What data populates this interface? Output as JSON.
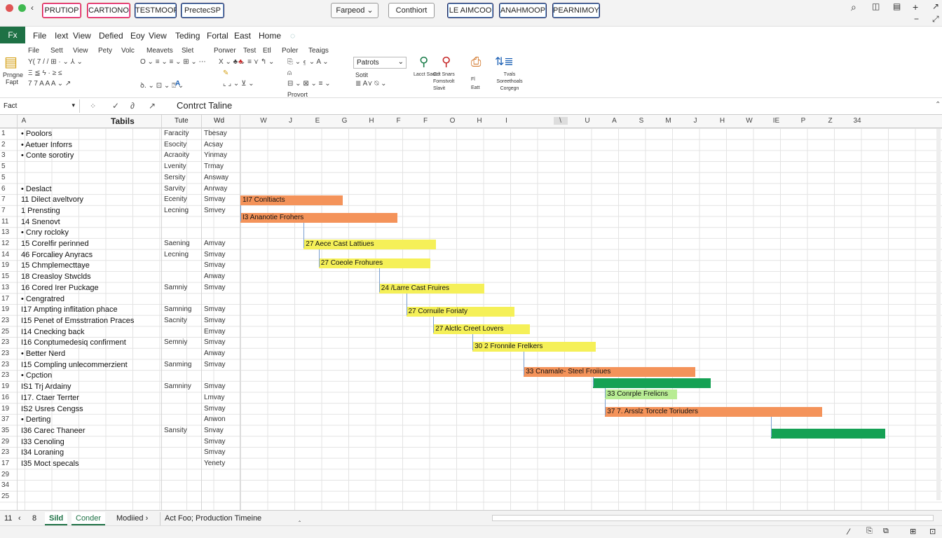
{
  "titlebar": {
    "buttons": [
      "PRUTIOP",
      "CARTIONO",
      "TESTMOOP",
      "PrectecSP",
      "Farpeod",
      "Conthiort",
      "LE AIMCOO",
      "ANAHMOOP",
      "PEARNIMOY"
    ],
    "dropdown": "⌄"
  },
  "menu": [
    "Fx",
    "File",
    "Iext",
    "View",
    "Defied",
    "Eoy",
    "View",
    "Teding",
    "Fortal",
    "East",
    "Home"
  ],
  "ribbon": {
    "sub": [
      "File",
      "Sett",
      "View",
      "Pety",
      "Volc",
      "Meavets",
      "Slet",
      "Porwer",
      "Test",
      "Etl",
      "Poler",
      "Teaigs"
    ],
    "font": "Patrots",
    "groups": [
      "Lacct Saotct Snars",
      "Crl Fomstvolt Slavit",
      "Fl Eatt",
      "Tvals Soreethoals Corgegn"
    ],
    "left": [
      "Prngne Fapt"
    ],
    "styles": "Sotit",
    "bottom": "Provort"
  },
  "formula_bar": {
    "name": "Fact",
    "value": "Contrct Taline"
  },
  "columns": [
    "W",
    "J",
    "E",
    "G",
    "H",
    "F",
    "F",
    "O",
    "H",
    "I",
    "",
    "\\",
    "U",
    "A",
    "S",
    "M",
    "J",
    "H",
    "W",
    "IE",
    "P",
    "Z",
    "34"
  ],
  "header": {
    "tasks": "Tabils",
    "resource": "Tute",
    "status": "Wd"
  },
  "rows": [
    {
      "n": "1",
      "task": "•  Poolors",
      "res": "Faracity",
      "stat": "Tbesay"
    },
    {
      "n": "2",
      "task": "•  Aetuer Inforrs",
      "res": "Esocity",
      "stat": "Acsay"
    },
    {
      "n": "3",
      "task": "•  Conte sorotiry",
      "res": "Acraoity",
      "stat": "Yinmay"
    },
    {
      "n": "5",
      "task": "",
      "res": "Lvenity",
      "stat": "Trmay"
    },
    {
      "n": "5",
      "task": "",
      "res": "Sersity",
      "stat": "Answay"
    },
    {
      "n": "6",
      "task": "•  Deslact",
      "res": "Sarvity",
      "stat": "Anrway"
    },
    {
      "n": "7",
      "task": "11  Dilect aveltvory",
      "res": "Ecenity",
      "stat": "Smvay"
    },
    {
      "n": "7",
      "task": "1   Prensting",
      "res": "Lecning",
      "stat": "Smvey"
    },
    {
      "n": "11",
      "task": "14  Snenovt",
      "res": "",
      "stat": ""
    },
    {
      "n": "13",
      "task": "    •  Cnry rocloky",
      "res": "",
      "stat": ""
    },
    {
      "n": "12",
      "task": "15  Corelfir perinned",
      "res": "Saening",
      "stat": "Amvay"
    },
    {
      "n": "14",
      "task": "46  Forcaliey Anyracs",
      "res": "Lecning",
      "stat": "Smvay"
    },
    {
      "n": "19",
      "task": "15  Chmplemecttaye",
      "res": "",
      "stat": "Smvay"
    },
    {
      "n": "15",
      "task": "18  Creasloy Stwclds",
      "res": "",
      "stat": "Anway"
    },
    {
      "n": "13",
      "task": "16  Cored Irer Puckage",
      "res": "Samniy",
      "stat": "Smvay"
    },
    {
      "n": "17",
      "task": "     •  Cengratred",
      "res": "",
      "stat": ""
    },
    {
      "n": "19",
      "task": "I17  Ampting inflitation phace",
      "res": "Samning",
      "stat": "Smvay"
    },
    {
      "n": "23",
      "task": "I15  Penet of Emsstrration Praces",
      "res": "Sacnity",
      "stat": "Smvay"
    },
    {
      "n": "25",
      "task": "I14  Cnecking back",
      "res": "",
      "stat": "Emvay"
    },
    {
      "n": "23",
      "task": "I16  Conptumedesiq confirment",
      "res": "Semniy",
      "stat": "Smvay"
    },
    {
      "n": "23",
      "task": "     •  Better Nerd",
      "res": "",
      "stat": "Anway"
    },
    {
      "n": "23",
      "task": "I15  Compling unlecommerzient",
      "res": "Sanming",
      "stat": "Smvay"
    },
    {
      "n": "23",
      "task": "     •  Cpction",
      "res": "",
      "stat": ""
    },
    {
      "n": "19",
      "task": "IS1  Trj Ardainy",
      "res": "Samniny",
      "stat": "Smvay"
    },
    {
      "n": "16",
      "task": "I17.  Ctaer Terrter",
      "res": "",
      "stat": "Lmvay"
    },
    {
      "n": "19",
      "task": "IS2  Usres Cengss",
      "res": "",
      "stat": "Smvay"
    },
    {
      "n": "37",
      "task": "     •  Derting",
      "res": "",
      "stat": "Anwon"
    },
    {
      "n": "35",
      "task": "I36  Carec Thaneer",
      "res": "Sansity",
      "stat": "Snvay"
    },
    {
      "n": "29",
      "task": "I33  Cenoling",
      "res": "",
      "stat": "Smvay"
    },
    {
      "n": "23",
      "task": "I34  Loraning",
      "res": "",
      "stat": "Smvay"
    },
    {
      "n": "17",
      "task": "I35  Moct specals",
      "res": "",
      "stat": "Yenety"
    },
    {
      "n": "29",
      "task": "",
      "res": "",
      "stat": ""
    },
    {
      "n": "34",
      "task": "",
      "res": "",
      "stat": ""
    },
    {
      "n": "25",
      "task": "",
      "res": "",
      "stat": ""
    }
  ],
  "gantt": [
    {
      "label": "1I7 Conltiacts",
      "color": "#f4935a",
      "row": 6,
      "start": 0.0,
      "end": 0.34
    },
    {
      "label": "I3 Ananotie Frohers",
      "color": "#f4935a",
      "row": 7.6,
      "start": 0.0,
      "end": 0.52
    },
    {
      "label": "27 Aece Cast Lattiues",
      "color": "#f5f058",
      "row": 10,
      "start": 0.21,
      "end": 0.65
    },
    {
      "label": "27 Coeole Frohures",
      "color": "#f5f058",
      "row": 11.7,
      "start": 0.26,
      "end": 0.63
    },
    {
      "label": "24 /Larre Cast Fruires",
      "color": "#f5f058",
      "row": 14,
      "start": 0.46,
      "end": 0.81
    },
    {
      "label": "27 Cornuile Foriaty",
      "color": "#f5f058",
      "row": 16.1,
      "start": 0.55,
      "end": 0.91
    },
    {
      "label": "27 Alctlc Creet Lovers",
      "color": "#f5f058",
      "row": 17.7,
      "start": 0.64,
      "end": 0.96
    },
    {
      "label": "30 2 Fronnile Frelkers",
      "color": "#f5f058",
      "row": 19.3,
      "start": 0.77,
      "end": 1.18
    },
    {
      "label": "33 Cnamale- Steel Froiiues",
      "color": "#f4935a",
      "row": 21.6,
      "start": 0.94,
      "end": 1.51
    },
    {
      "label": "",
      "color": "#15a154",
      "row": 22.6,
      "start": 1.17,
      "end": 1.56
    },
    {
      "label": "33 Conrple Frelicns",
      "color": "#b8ec94",
      "row": 23.6,
      "start": 1.21,
      "end": 1.45
    },
    {
      "label": "37 7. Arsslz Torccle Toriuders",
      "color": "#f4935a",
      "row": 25.2,
      "start": 1.21,
      "end": 1.93
    },
    {
      "label": "",
      "color": "#15a154",
      "row": 27.2,
      "start": 1.76,
      "end": 2.14
    }
  ],
  "sheets": {
    "nav": [
      "11",
      "‹",
      "8"
    ],
    "tabs": [
      "Sild",
      "Conder",
      "Modiied  ›",
      "Act Foo; Production Timeine",
      "‸"
    ]
  },
  "status_icons": [
    "pencil-icon",
    "page-icon",
    "layout-icon",
    "grid-icon",
    "zoom-icon"
  ]
}
